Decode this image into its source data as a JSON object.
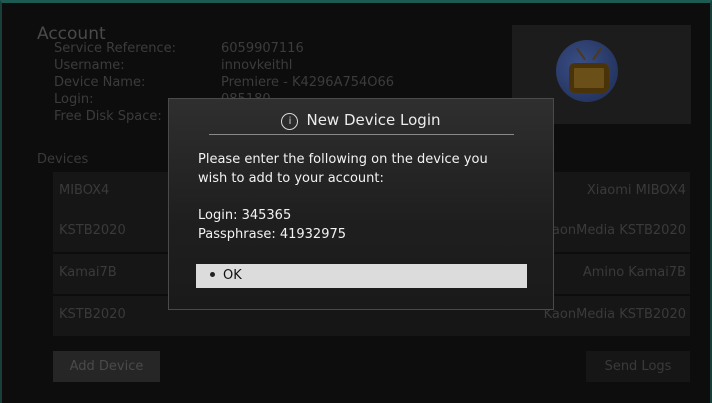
{
  "account": {
    "title": "Account",
    "rows": [
      {
        "label": "Service Reference:",
        "value": "6059907116"
      },
      {
        "label": "Username:",
        "value": "innovkeithl"
      },
      {
        "label": "Device Name:",
        "value": "Premiere - K4296A754O66"
      },
      {
        "label": "Login:",
        "value": "085180"
      },
      {
        "label": "Free Disk Space:",
        "value": ""
      }
    ]
  },
  "devices": {
    "label": "Devices",
    "items": [
      {
        "name": "MIBOX4",
        "model": "Xiaomi MIBOX4"
      },
      {
        "name": "KSTB2020",
        "model": "KaonMedia KSTB2020"
      },
      {
        "name": "Kamai7B",
        "model": "Amino Kamai7B"
      },
      {
        "name": "KSTB2020",
        "model": "KaonMedia KSTB2020"
      }
    ]
  },
  "buttons": {
    "add_device": "Add Device",
    "send_logs": "Send Logs"
  },
  "dialog": {
    "icon": "info-icon",
    "title": "New Device Login",
    "line1": "Please enter the following on the device you",
    "line2": "wish to add to your account:",
    "login": "Login: 345365",
    "passphrase": "Passphrase: 41932975",
    "ok": "OK"
  },
  "colors": {
    "frame_accent": "#1d5b52",
    "button_selected": "#dcdcdc"
  }
}
